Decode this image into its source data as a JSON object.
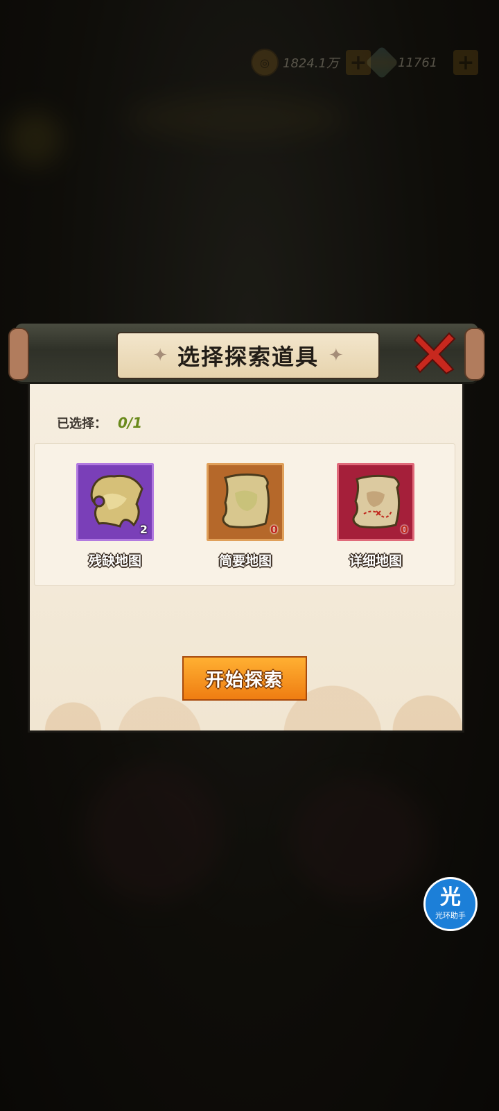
{
  "currency": {
    "gold_amount": "1824.1万",
    "gem_amount": "11761",
    "plus_symbol": "+"
  },
  "dialog": {
    "title": "选择探索道具",
    "title_ornament": "✦",
    "close_icon": "close-x-icon",
    "selected_label": "已选择：",
    "selected_value": "0/1",
    "start_button": "开始探索"
  },
  "items": [
    {
      "name": "残缺地图",
      "count": "2",
      "icon": "broken-map-icon",
      "frame_color": "#8a4cc2",
      "bg_color": "#6a35a8"
    },
    {
      "name": "简要地图",
      "count": "0",
      "icon": "simple-map-icon",
      "frame_color": "#d08a44",
      "bg_color": "#b3662a"
    },
    {
      "name": "详细地图",
      "count": "0",
      "icon": "detailed-map-icon",
      "frame_color": "#c23a4e",
      "bg_color": "#a01f38"
    }
  ],
  "assistant": {
    "glyph": "光",
    "label": "光环助手"
  }
}
